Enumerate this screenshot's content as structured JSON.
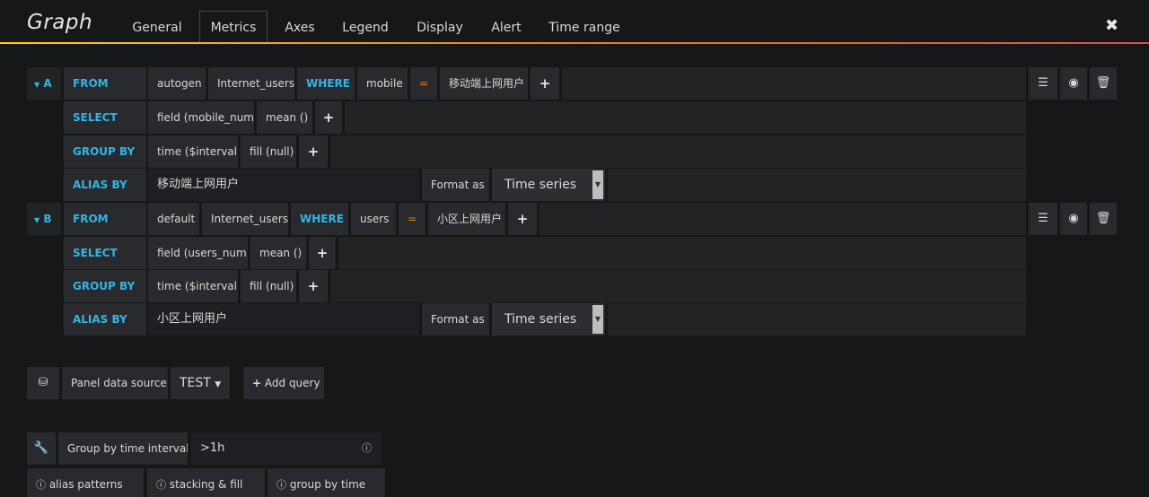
{
  "panel": {
    "title": "Graph",
    "close_label": "✖",
    "tabs": [
      {
        "label": "General"
      },
      {
        "label": "Metrics"
      },
      {
        "label": "Axes"
      },
      {
        "label": "Legend"
      },
      {
        "label": "Display"
      },
      {
        "label": "Alert"
      },
      {
        "label": "Time range"
      }
    ],
    "active_tab": "Metrics"
  },
  "queries": [
    {
      "ref": "A",
      "from_kw": "FROM",
      "policy": "autogen",
      "measurement": "Internet_users",
      "where_kw": "WHERE",
      "tag_key": "mobile",
      "operator": "=",
      "tag_value": "移动端上网用户",
      "select_kw": "SELECT",
      "field": "field (mobile_num)",
      "agg": "mean ()",
      "group_kw": "GROUP BY",
      "group_time": "time ($interval)",
      "group_fill": "fill (null)",
      "alias_kw": "ALIAS BY",
      "alias": "移动端上网用户",
      "format_label": "Format as",
      "format_value": "Time series"
    },
    {
      "ref": "B",
      "from_kw": "FROM",
      "policy": "default",
      "measurement": "Internet_users",
      "where_kw": "WHERE",
      "tag_key": "users",
      "operator": "=",
      "tag_value": "小区上网用户",
      "select_kw": "SELECT",
      "field": "field (users_num)",
      "agg": "mean ()",
      "group_kw": "GROUP BY",
      "group_time": "time ($interval)",
      "group_fill": "fill (null)",
      "alias_kw": "ALIAS BY",
      "alias": "小区上网用户",
      "format_label": "Format as",
      "format_value": "Time series"
    }
  ],
  "datasource": {
    "label": "Panel data source",
    "value": "TEST",
    "add_query": "Add query"
  },
  "options": {
    "interval_label": "Group by time interval",
    "interval_value": ">1h",
    "help": [
      "alias patterns",
      "stacking & fill",
      "group by time"
    ]
  },
  "colors": {
    "background": "#161719",
    "keyword": "#33b5e5",
    "operator": "#eb7b18",
    "accent_gradient": [
      "#ffd400",
      "#f28a18",
      "#e24d42"
    ]
  },
  "icons": {
    "ref_toggle": "caret-down-icon",
    "menu": "hamburger-icon",
    "eye": "eye-icon",
    "delete": "trash-icon",
    "datasource": "database-icon",
    "wrench": "wrench-icon",
    "info": "info-circle-icon"
  }
}
